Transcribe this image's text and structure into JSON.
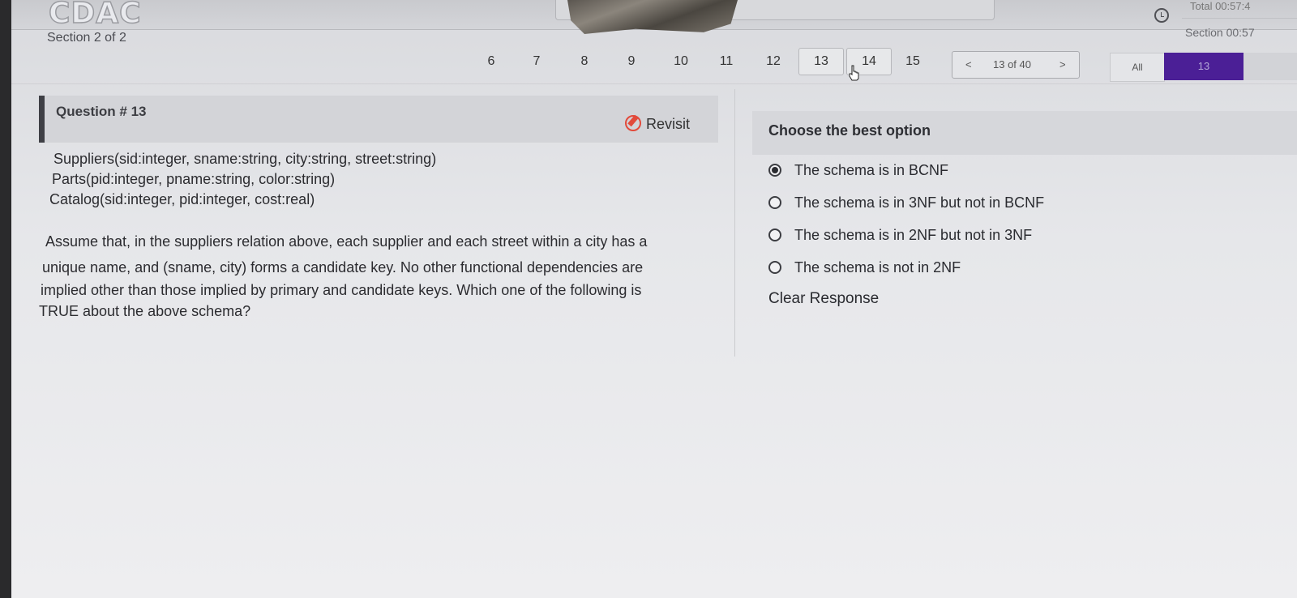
{
  "header": {
    "logo": "CDAC",
    "timer_total": "Total 00:57:4",
    "timer_section": "Section 00:57"
  },
  "section_label": "Section 2 of 2",
  "nav": {
    "question_numbers": [
      "6",
      "7",
      "8",
      "9",
      "10",
      "11",
      "12",
      "13",
      "14",
      "15"
    ],
    "prev": "<",
    "position": "13 of 40",
    "next": ">",
    "filter_all": "All",
    "filter_current": "13"
  },
  "question": {
    "title": "Question # 13",
    "revisit_label": "Revisit",
    "lines": [
      "Suppliers(sid:integer, sname:string, city:string, street:string)",
      "Parts(pid:integer, pname:string, color:string)",
      "Catalog(sid:integer, pid:integer, cost:real)"
    ],
    "paragraph": [
      "Assume that, in the suppliers relation above, each supplier and each street within a city has a",
      "unique name, and (sname, city) forms a candidate key. No other functional dependencies are",
      "implied other than those implied by primary and candidate keys. Which one of the following is",
      "TRUE about the above schema?"
    ]
  },
  "answer": {
    "header": "Choose the best option",
    "options": [
      {
        "label": "The schema is in BCNF",
        "selected": true
      },
      {
        "label": "The schema is in 3NF but not in BCNF",
        "selected": false
      },
      {
        "label": "The schema is in 2NF but not in 3NF",
        "selected": false
      },
      {
        "label": "The schema is not in 2NF",
        "selected": false
      }
    ],
    "clear_label": "Clear Response"
  }
}
